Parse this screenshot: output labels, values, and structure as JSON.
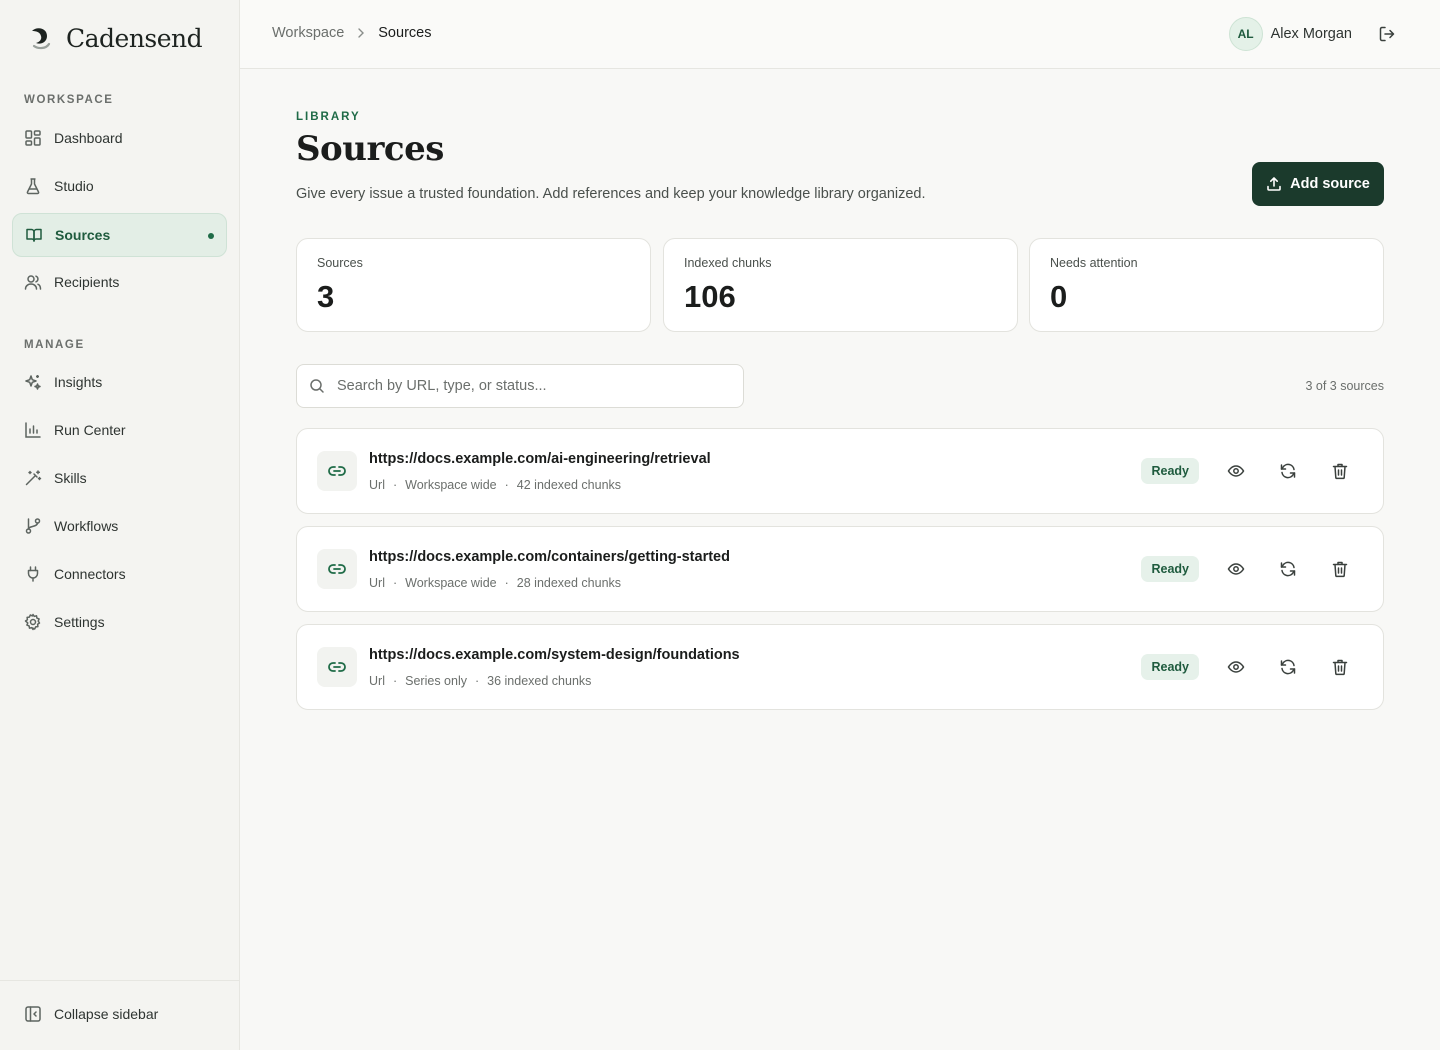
{
  "app": {
    "name": "Cadensend"
  },
  "sidebar": {
    "sections": [
      {
        "title": "WORKSPACE"
      },
      {
        "title": "MANAGE"
      }
    ],
    "items": [
      {
        "label": "Dashboard",
        "icon": "dashboard-icon"
      },
      {
        "label": "Studio",
        "icon": "flask-icon"
      },
      {
        "label": "Sources",
        "icon": "book-icon",
        "active": true
      },
      {
        "label": "Recipients",
        "icon": "users-icon"
      },
      {
        "label": "Insights",
        "icon": "sparkles-icon"
      },
      {
        "label": "Run Center",
        "icon": "bar-chart-icon"
      },
      {
        "label": "Skills",
        "icon": "wand-icon"
      },
      {
        "label": "Workflows",
        "icon": "git-branch-icon"
      },
      {
        "label": "Connectors",
        "icon": "plug-icon"
      },
      {
        "label": "Settings",
        "icon": "gear-icon"
      }
    ],
    "collapse_label": "Collapse sidebar"
  },
  "topbar": {
    "breadcrumb": {
      "parent": "Workspace",
      "current": "Sources"
    },
    "user": {
      "initials": "AL",
      "name": "Alex Morgan"
    }
  },
  "page": {
    "eyebrow": "LIBRARY",
    "title": "Sources",
    "subtitle": "Give every issue a trusted foundation. Add references and keep your knowledge library organized.",
    "add_button": "Add source"
  },
  "stats": [
    {
      "label": "Sources",
      "value": "3"
    },
    {
      "label": "Indexed chunks",
      "value": "106"
    },
    {
      "label": "Needs attention",
      "value": "0"
    }
  ],
  "search": {
    "placeholder": "Search by URL, type, or status...",
    "value": ""
  },
  "count_text": "3 of 3 sources",
  "sources": [
    {
      "url": "https://docs.example.com/ai-engineering/retrieval",
      "type": "Url",
      "scope": "Workspace wide",
      "chunks": "42 indexed chunks",
      "status": "Ready"
    },
    {
      "url": "https://docs.example.com/containers/getting-started",
      "type": "Url",
      "scope": "Workspace wide",
      "chunks": "28 indexed chunks",
      "status": "Ready"
    },
    {
      "url": "https://docs.example.com/system-design/foundations",
      "type": "Url",
      "scope": "Series only",
      "chunks": "36 indexed chunks",
      "status": "Ready"
    }
  ],
  "colors": {
    "accent": "#1f6b47",
    "primary_button": "#1b3a2c",
    "active_nav_bg": "#e3eee6",
    "badge_bg": "#e6f1ea"
  }
}
